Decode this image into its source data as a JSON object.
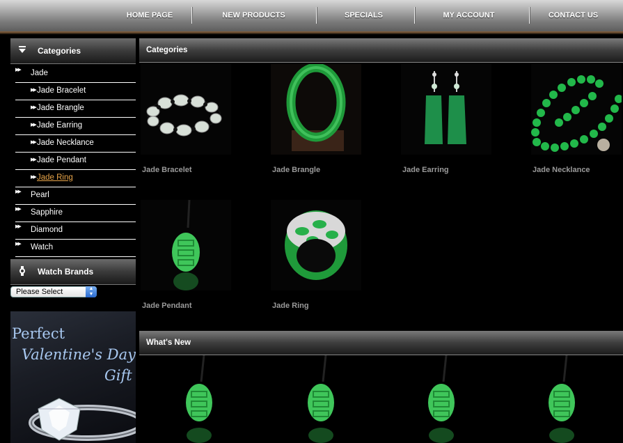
{
  "nav": {
    "items": [
      "HOME PAGE",
      "NEW PRODUCTS",
      "SPECIALS",
      "MY ACCOUNT",
      "CONTACT US"
    ]
  },
  "sidebar": {
    "categories_title": "Categories",
    "categories": [
      {
        "label": "Jade",
        "level": 0,
        "active": false
      },
      {
        "label": "Jade Bracelet",
        "level": 1,
        "active": false
      },
      {
        "label": "Jade Brangle",
        "level": 1,
        "active": false
      },
      {
        "label": "Jade Earring",
        "level": 1,
        "active": false
      },
      {
        "label": "Jade Necklance",
        "level": 1,
        "active": false
      },
      {
        "label": "Jade Pendant",
        "level": 1,
        "active": false
      },
      {
        "label": "Jade Ring",
        "level": 1,
        "active": true
      },
      {
        "label": "Pearl",
        "level": 0,
        "active": false
      },
      {
        "label": "Sapphire",
        "level": 0,
        "active": false
      },
      {
        "label": "Diamond",
        "level": 0,
        "active": false
      },
      {
        "label": "Watch",
        "level": 0,
        "active": false
      }
    ],
    "watch_brands_title": "Watch Brands",
    "watch_select_value": "Please Select",
    "promo": {
      "line1": "Perfect",
      "line2": "Valentine's Day",
      "line3": "Gift"
    }
  },
  "main": {
    "categories_title": "Categories",
    "products": [
      {
        "name": "Jade Bracelet",
        "icon": "jade-bracelet-image"
      },
      {
        "name": "Jade Brangle",
        "icon": "jade-bangle-image"
      },
      {
        "name": "Jade Earring",
        "icon": "jade-earring-image"
      },
      {
        "name": "Jade Necklance",
        "icon": "jade-necklace-image"
      },
      {
        "name": "Jade Pendant",
        "icon": "jade-pendant-image"
      },
      {
        "name": "Jade Ring",
        "icon": "jade-ring-image"
      }
    ],
    "whats_new_title": "What's New"
  },
  "colors": {
    "jade": "#2aa84a",
    "active_link": "#e8a54a",
    "product_name": "#9a9a9a"
  }
}
